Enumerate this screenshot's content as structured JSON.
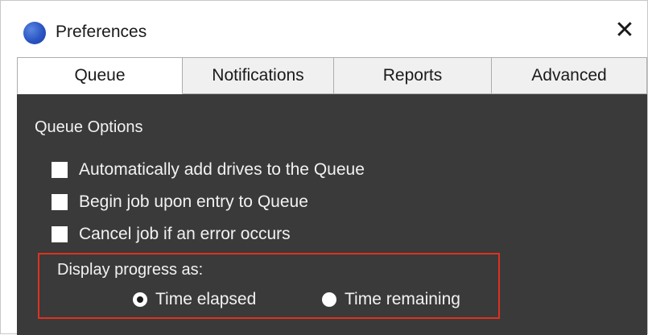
{
  "window": {
    "title": "Preferences",
    "close_symbol": "✕",
    "app_icon": "app-circle-icon"
  },
  "tabs": [
    {
      "label": "Queue",
      "active": true
    },
    {
      "label": "Notifications",
      "active": false
    },
    {
      "label": "Reports",
      "active": false
    },
    {
      "label": "Advanced",
      "active": false
    }
  ],
  "queue_options": {
    "group_label": "Queue Options",
    "checkboxes": [
      {
        "label": "Automatically add drives to the Queue",
        "checked": false
      },
      {
        "label": "Begin job upon entry to Queue",
        "checked": false
      },
      {
        "label": "Cancel job if an error occurs",
        "checked": false
      }
    ]
  },
  "display_progress": {
    "label": "Display progress as:",
    "options": [
      {
        "label": "Time elapsed",
        "selected": true
      },
      {
        "label": "Time remaining",
        "selected": false
      }
    ]
  },
  "colors": {
    "panel_bg": "#3a3a3a",
    "highlight_border": "#e0311f",
    "app_icon": "#2a55c4"
  }
}
